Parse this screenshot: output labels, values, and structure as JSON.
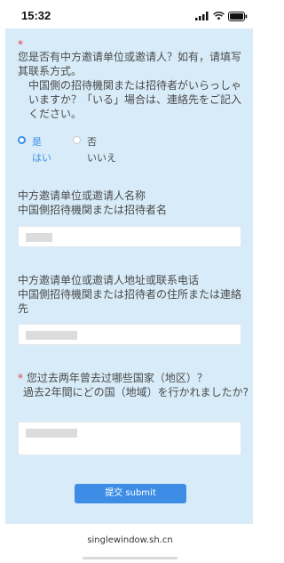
{
  "status": {
    "time": "15:32"
  },
  "question_1": {
    "required_mark": "*",
    "zh": "您是否有中方邀请单位或邀请人？如有，请填写其联系方式。",
    "ja": "中国側の招待機関または招待者がいらっしゃいますか？「いる」場合は、連絡先をご記入ください。"
  },
  "radio": {
    "yes": {
      "zh": "是",
      "ja": "はい",
      "selected": true
    },
    "no": {
      "zh": "否",
      "ja": "いいえ",
      "selected": false
    }
  },
  "question_2": {
    "zh": "中方邀请单位或邀请人名称",
    "ja": "中国側招待機関または招待者名"
  },
  "question_3": {
    "zh": "中方邀请单位或邀请人地址或联系电话",
    "ja": "中国側招待機関または招待者の住所または連絡先"
  },
  "question_4": {
    "required_mark": "*",
    "zh": "您过去两年曾去过哪些国家（地区）？",
    "ja": "過去2年間にどの国（地域）を行かれましたか?"
  },
  "submit": {
    "label": "提交 submit"
  },
  "browser": {
    "url": "singlewindow.sh.cn"
  },
  "colors": {
    "panel": "#d7ecf8",
    "accent": "#3d8de6",
    "required": "#e0413a"
  }
}
